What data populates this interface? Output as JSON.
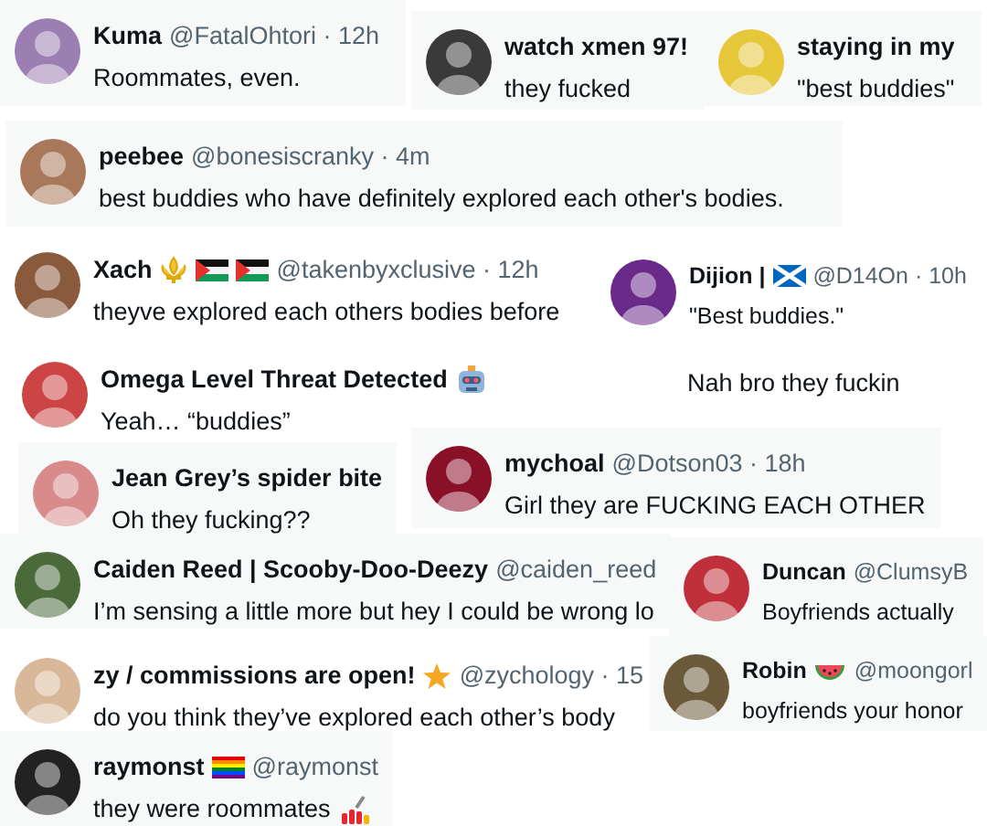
{
  "replies": [
    {
      "kind": "reply",
      "name": "Kuma",
      "meta": "@FatalOhtori · 12h",
      "text": "Roommates, even."
    },
    {
      "kind": "reply",
      "name": "watch xmen 97!",
      "text": "they fucked"
    },
    {
      "kind": "reply",
      "name": "staying in my",
      "text": "\"best buddies\""
    },
    {
      "kind": "reply",
      "name": "peebee",
      "meta": "@bonesiscranky · 4m",
      "text": "best buddies who have definitely explored each other's bodies."
    },
    {
      "kind": "reply",
      "name": "Xach",
      "meta": "@takenbyxclusive · 12h",
      "text": "theyve explored each others bodies before"
    },
    {
      "kind": "reply",
      "name": "Dijion |",
      "meta": "@D14On · 10h",
      "text": "\"Best buddies.\""
    },
    {
      "kind": "reply",
      "name": "Omega Level Threat Detected",
      "text": "Yeah… “buddies”"
    },
    {
      "kind": "text",
      "text": "Nah bro they fuckin"
    },
    {
      "kind": "reply",
      "name": "Jean Grey’s spider bite",
      "text": "Oh they fucking??"
    },
    {
      "kind": "reply",
      "name": "mychoal",
      "meta": "@Dotson03 · 18h",
      "text": "Girl they are FUCKING EACH OTHER"
    },
    {
      "kind": "reply",
      "name": "Caiden Reed | Scooby-Doo-Deezy",
      "meta": "@caiden_reed",
      "text": "I’m sensing a little more but hey I could be wrong lo"
    },
    {
      "kind": "reply",
      "name": "Duncan",
      "meta": "@ClumsyB",
      "text": "Boyfriends actually"
    },
    {
      "kind": "reply",
      "name": "zy / commissions are open!",
      "meta": "@zychology · 15",
      "text": "do you think they’ve explored each other’s body"
    },
    {
      "kind": "reply",
      "name": "Robin",
      "meta": "@moongorl",
      "text": "boyfriends your honor"
    },
    {
      "kind": "reply",
      "name": "raymonst",
      "meta": "@raymonst",
      "text": "they were roommates"
    }
  ]
}
